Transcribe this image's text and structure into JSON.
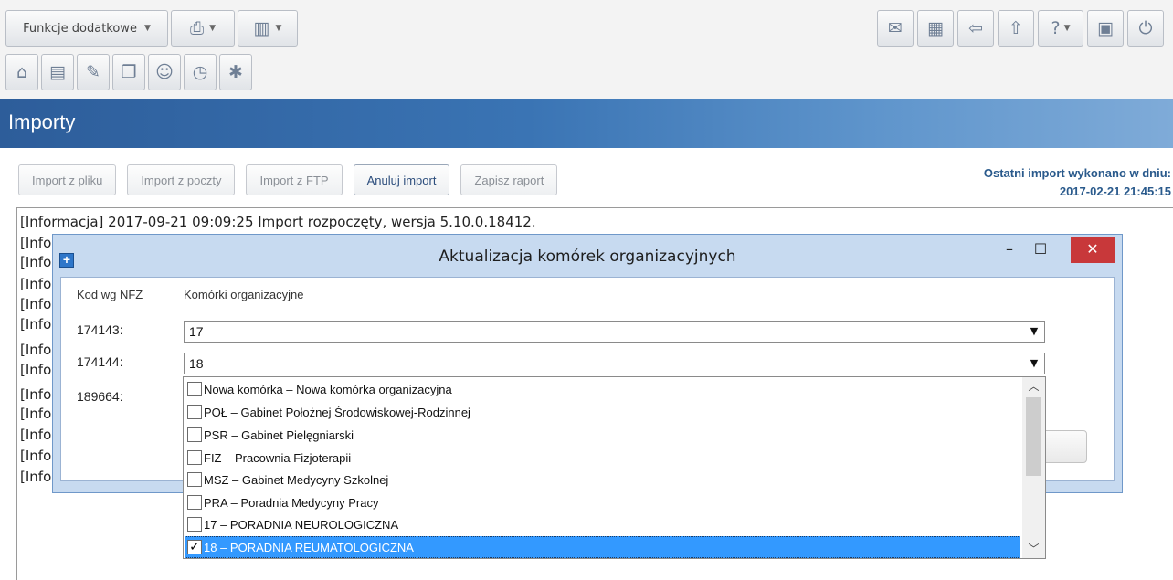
{
  "toolbar": {
    "extras_label": "Funkcje dodatkowe",
    "row1_icons": [
      "printer-icon",
      "layout-icon"
    ],
    "row2_icons": [
      "home-icon",
      "window-icon",
      "notes-icon",
      "documents-icon",
      "people-icon",
      "clock-icon",
      "settings-icon"
    ],
    "right_icons": [
      "mail-icon",
      "calculator-icon",
      "back-icon",
      "up-icon",
      "help-icon",
      "lock-icon",
      "power-icon"
    ]
  },
  "page": {
    "title": "Importy"
  },
  "actions": {
    "import_file": "Import z pliku",
    "import_mail": "Import z poczty",
    "import_ftp": "Import z FTP",
    "cancel_import": "Anuluj import",
    "save_report": "Zapisz raport"
  },
  "last_import": {
    "label": "Ostatni import wykonano w dniu:",
    "datetime": "2017-02-21 21:45:15"
  },
  "log": {
    "lines": [
      "[Informacja] 2017-09-21 09:09:25 Import rozpoczęty, wersja 5.10.0.18412.",
      "[Info",
      "[Info",
      "[Info",
      "[Info",
      "[Info",
      "[Info",
      "[Info",
      "[Info",
      "[Info",
      "[Info",
      "[Info",
      "[Info"
    ]
  },
  "dialog": {
    "title": "Aktualizacja komórek organizacyjnych",
    "col_code": "Kod wg NFZ",
    "col_units": "Komórki organizacyjne",
    "rows": [
      {
        "code": "174143:",
        "value": "17"
      },
      {
        "code": "174144:",
        "value": "18"
      },
      {
        "code": "189664:",
        "value": ""
      }
    ]
  },
  "dropdown": {
    "options": [
      {
        "label": "Nowa komórka – Nowa komórka organizacyjna",
        "checked": false
      },
      {
        "label": "POŁ – Gabinet Położnej Środowiskowej-Rodzinnej",
        "checked": false
      },
      {
        "label": "PSR – Gabinet Pielęgniarski",
        "checked": false
      },
      {
        "label": "FIZ – Pracownia Fizjoterapii",
        "checked": false
      },
      {
        "label": "MSZ – Gabinet Medycyny Szkolnej",
        "checked": false
      },
      {
        "label": "PRA – Poradnia Medycyny Pracy",
        "checked": false
      },
      {
        "label": "17 – PORADNIA NEUROLOGICZNA",
        "checked": false
      },
      {
        "label": "18 – PORADNIA REUMATOLOGICZNA",
        "checked": true,
        "selected": true
      }
    ]
  }
}
